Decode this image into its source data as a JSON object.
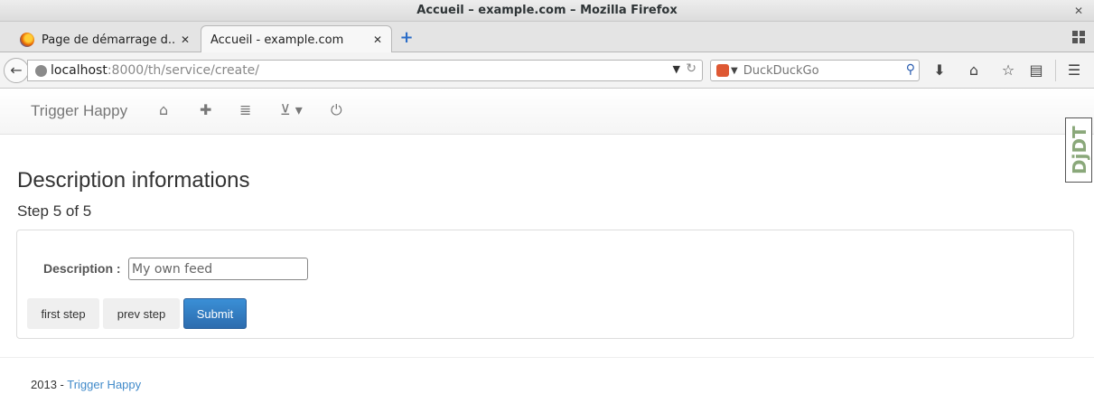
{
  "window": {
    "title": "Accueil – example.com – Mozilla Firefox"
  },
  "tabs": [
    {
      "label": "Page de démarrage d...",
      "active": false
    },
    {
      "label": "Accueil - example.com",
      "active": true
    }
  ],
  "nav": {
    "url_host": "localhost",
    "url_rest": ":8000/th/service/create/",
    "search_placeholder": "DuckDuckGo"
  },
  "app": {
    "brand": "Trigger Happy",
    "djdt_label": "DjDT"
  },
  "form": {
    "title": "Description informations",
    "step": "Step 5 of 5",
    "description_label": "Description :",
    "description_value": "My own feed",
    "buttons": {
      "first": "first step",
      "prev": "prev step",
      "submit": "Submit"
    }
  },
  "footer": {
    "prefix": "2013 - ",
    "link": "Trigger Happy"
  },
  "colors": {
    "primary": "#337ab7",
    "link": "#428bca"
  }
}
